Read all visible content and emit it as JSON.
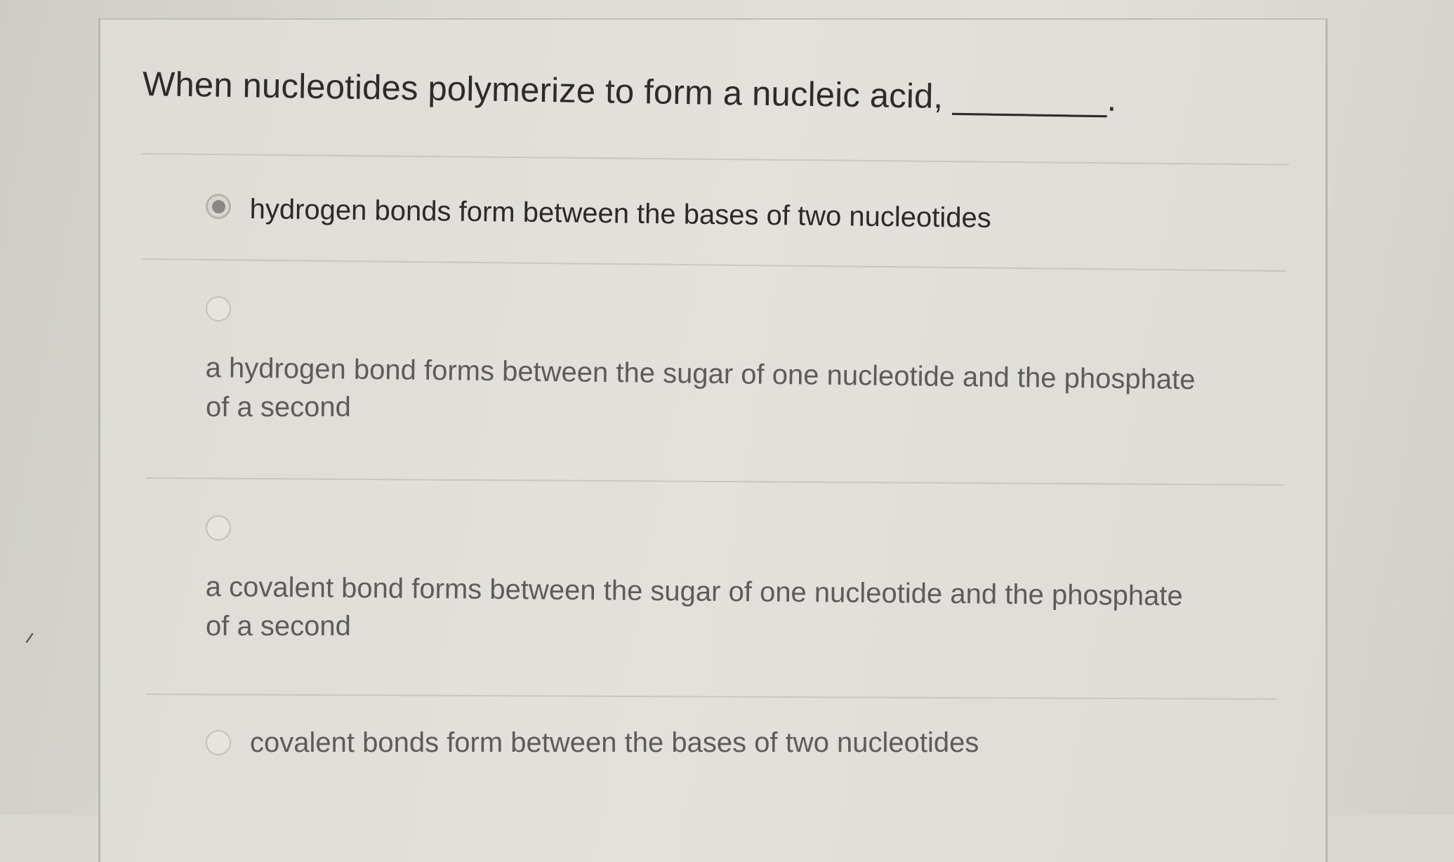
{
  "question": {
    "text": "When nucleotides polymerize to form a nucleic acid, ________."
  },
  "options": [
    {
      "label": "hydrogen bonds form between the bases of two nucleotides",
      "selected": true
    },
    {
      "label_line1": "a hydrogen bond forms between the sugar of one nucleotide and the phosphate",
      "label_line2": "of a second",
      "selected": false
    },
    {
      "label_line1": "a covalent bond forms between the sugar of one nucleotide and the phosphate",
      "label_line2": "of a second",
      "selected": false
    },
    {
      "label": "covalent bonds form between the bases of two nucleotides",
      "selected": false
    }
  ]
}
